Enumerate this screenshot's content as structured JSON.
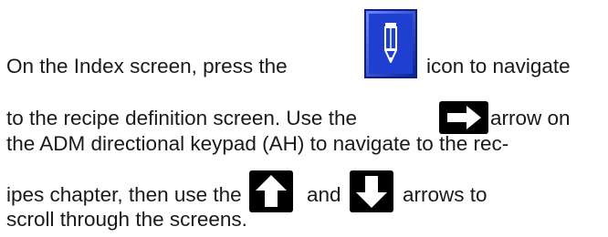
{
  "paragraph": {
    "line1_before": "On the Index screen, press the",
    "line1_after": "icon to navigate",
    "line2_before": "to the recipe definition screen. Use the",
    "line2_after": "arrow on",
    "line3": "the ADM directional keypad (AH) to navigate to the rec-",
    "line4_before": "ipes chapter, then use the",
    "line4_middle": "and",
    "line4_after": "arrows to",
    "line5": "scroll through the screens."
  },
  "icons": {
    "edit": "pencil-icon",
    "right": "right-arrow-icon",
    "up": "up-arrow-icon",
    "down": "down-arrow-icon"
  },
  "colors": {
    "text": "#1a1a1a",
    "edit_button_fill": "#1f3fd0",
    "edit_button_border": "#0a1e8c",
    "arrow_key_fill": "#000000",
    "arrow_glyph": "#ffffff"
  }
}
